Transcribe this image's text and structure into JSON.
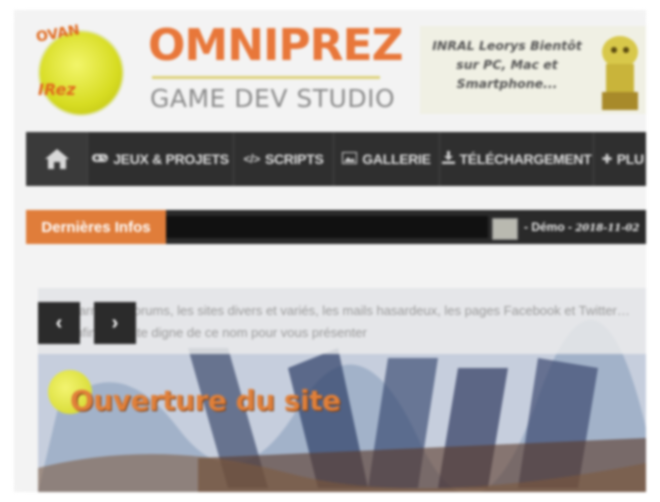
{
  "header": {
    "logo_text_top": "OVAN",
    "logo_text_bottom": "IRez",
    "brand_title": "OMNIPREZ",
    "brand_subtitle": "GAME DEV STUDIO",
    "promo_text": "INRAL Leorys Bientôt sur PC, Mac et Smartphone..."
  },
  "nav": {
    "items": [
      {
        "label": "",
        "icon": "home-icon"
      },
      {
        "label": "JEUX & PROJETS",
        "icon": "gamepad-icon"
      },
      {
        "label": "SCRIPTS",
        "icon": "code-icon"
      },
      {
        "label": "GALLERIE",
        "icon": "image-icon"
      },
      {
        "label": "TÉLÉCHARGEMENT",
        "icon": "download-icon"
      },
      {
        "label": "PLU",
        "icon": "plus-icon"
      }
    ]
  },
  "ticker": {
    "label": "Dernières Infos",
    "item_text": "- Démo -",
    "item_date": "2018-11-02"
  },
  "slider": {
    "caption": "Marre des forums, les sites divers et variés, les mails hasardeux, les pages Facebook et Twitter… enfin d'un site digne de ce nom pour vous présenter",
    "slide_title": "Ouverture du site",
    "prev_label": "‹",
    "next_label": "›"
  },
  "colors": {
    "accent": "#e07d3a",
    "nav_bg": "#2f2f2f",
    "logo_yellow": "#d7dc22"
  }
}
